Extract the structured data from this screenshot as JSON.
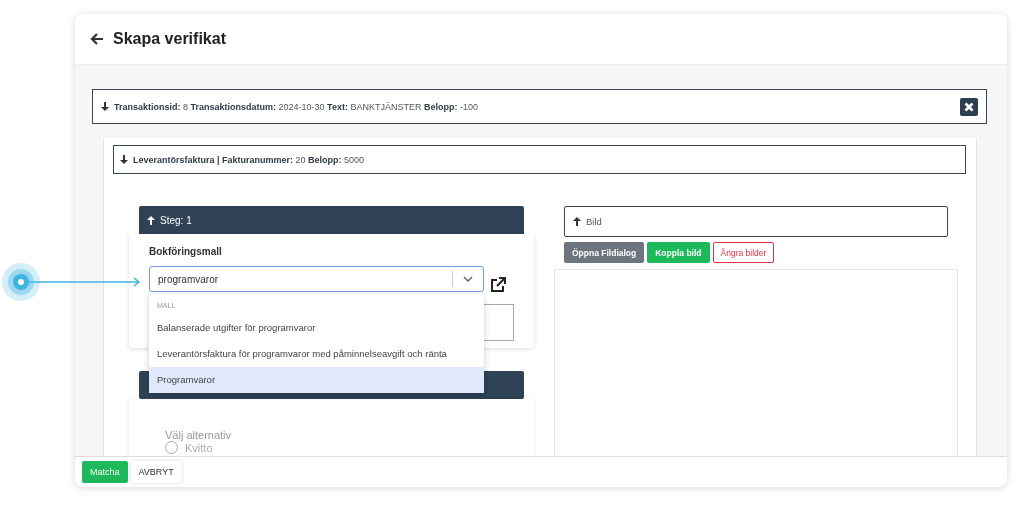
{
  "page": {
    "title": "Skapa verifikat"
  },
  "transaction": {
    "summary": "**Transaktionsid:** 8 **Transaktionsdatum:** 2024-10-30 **Text:** BANKTJÄNSTER **Belopp:** -100",
    "expanded": true
  },
  "invoice": {
    "summary": "**Leverantörsfaktura | Fakturanummer:** 20 **Belopp:** 5000",
    "expanded": true
  },
  "step": {
    "title": "Steg: 1",
    "expanded": false
  },
  "template_field": {
    "label": "Bokföringsmall",
    "value": "programvaror"
  },
  "dropdown": {
    "group": "MALL",
    "options": [
      {
        "label": "Balanserade utgifter för programvaror",
        "selected": false
      },
      {
        "label": "Leverantörsfaktura för programvaror med påminnelseavgift och ränta",
        "selected": false
      },
      {
        "label": "Programvaror",
        "selected": true
      }
    ]
  },
  "choice": {
    "label": "Välj alternativ",
    "options": [
      {
        "label": "Kvitto",
        "checked": false
      }
    ]
  },
  "image_panel": {
    "title": "Bild",
    "buttons": [
      {
        "label": "Öppna Fildialog",
        "kind": "secondary"
      },
      {
        "label": "Koppla bild",
        "kind": "success"
      },
      {
        "label": "Ångra bilder",
        "kind": "danger-outline"
      }
    ]
  },
  "footer": {
    "buttons": [
      {
        "label": "Matcha",
        "kind": "success"
      },
      {
        "label": "AVBRYT",
        "kind": "plain"
      }
    ]
  }
}
